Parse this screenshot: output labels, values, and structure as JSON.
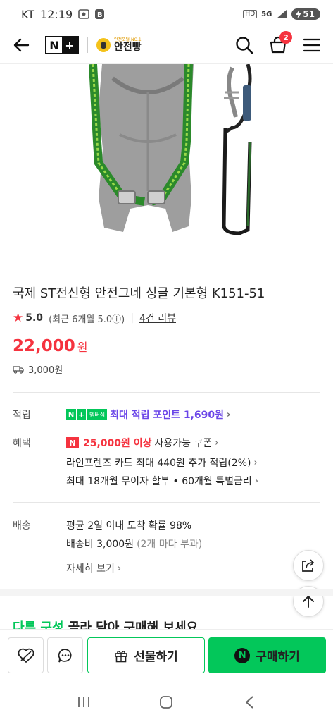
{
  "status_bar": {
    "carrier": "KT",
    "time": "12:19",
    "battery": "51",
    "network": "5G",
    "hd": "HD"
  },
  "header": {
    "nplus_n": "N",
    "nplus_plus": "+",
    "brand_sub": "안전포털 NO.1",
    "brand_name": "안전빵",
    "cart_count": "2"
  },
  "product": {
    "title": "국제 ST전신형 안전그네 싱글 기본형 K151-51",
    "rating_score": "5.0",
    "rating_detail": "(최근 6개월 5.0ⓘ)",
    "rating_sep": "|",
    "review_link": "4건 리뷰",
    "price": "22,000",
    "price_unit": "원",
    "shipping_fee": "3,000원"
  },
  "points": {
    "label": "적립",
    "membership_badge": "멤버십",
    "text": "최대 적립 포인트 1,690원"
  },
  "benefits": {
    "label": "혜택",
    "coupon_amount": "25,000원 이상",
    "coupon_text": "사용가능 쿠폰",
    "card_text": "라인프렌즈 카드 최대 440원 추가 적립(2%)",
    "installment_text": "최대 18개월 무이자 할부 • 60개월 특별금리"
  },
  "delivery": {
    "label": "배송",
    "arrival_text": "평균 2일 이내 도착 확률 98%",
    "fee_text": "배송비 3,000원",
    "fee_note": "(2개 마다 부과)",
    "detail_link": "자세히 보기"
  },
  "recommend": {
    "highlight": "다른 구성",
    "text": " 골라 담아 구매해 보세요"
  },
  "actionbar": {
    "gift_label": "선물하기",
    "buy_label": "구매하기",
    "buy_n": "N"
  },
  "colors": {
    "naver_green": "#03c75a",
    "price_red": "#f5333f",
    "points_purple": "#6a45e8"
  },
  "icons": [
    "back-arrow-icon",
    "search-icon",
    "cart-icon",
    "menu-icon",
    "star-icon",
    "truck-icon",
    "share-icon",
    "arrow-up-icon",
    "heart-icon",
    "chat-icon",
    "gift-icon"
  ]
}
